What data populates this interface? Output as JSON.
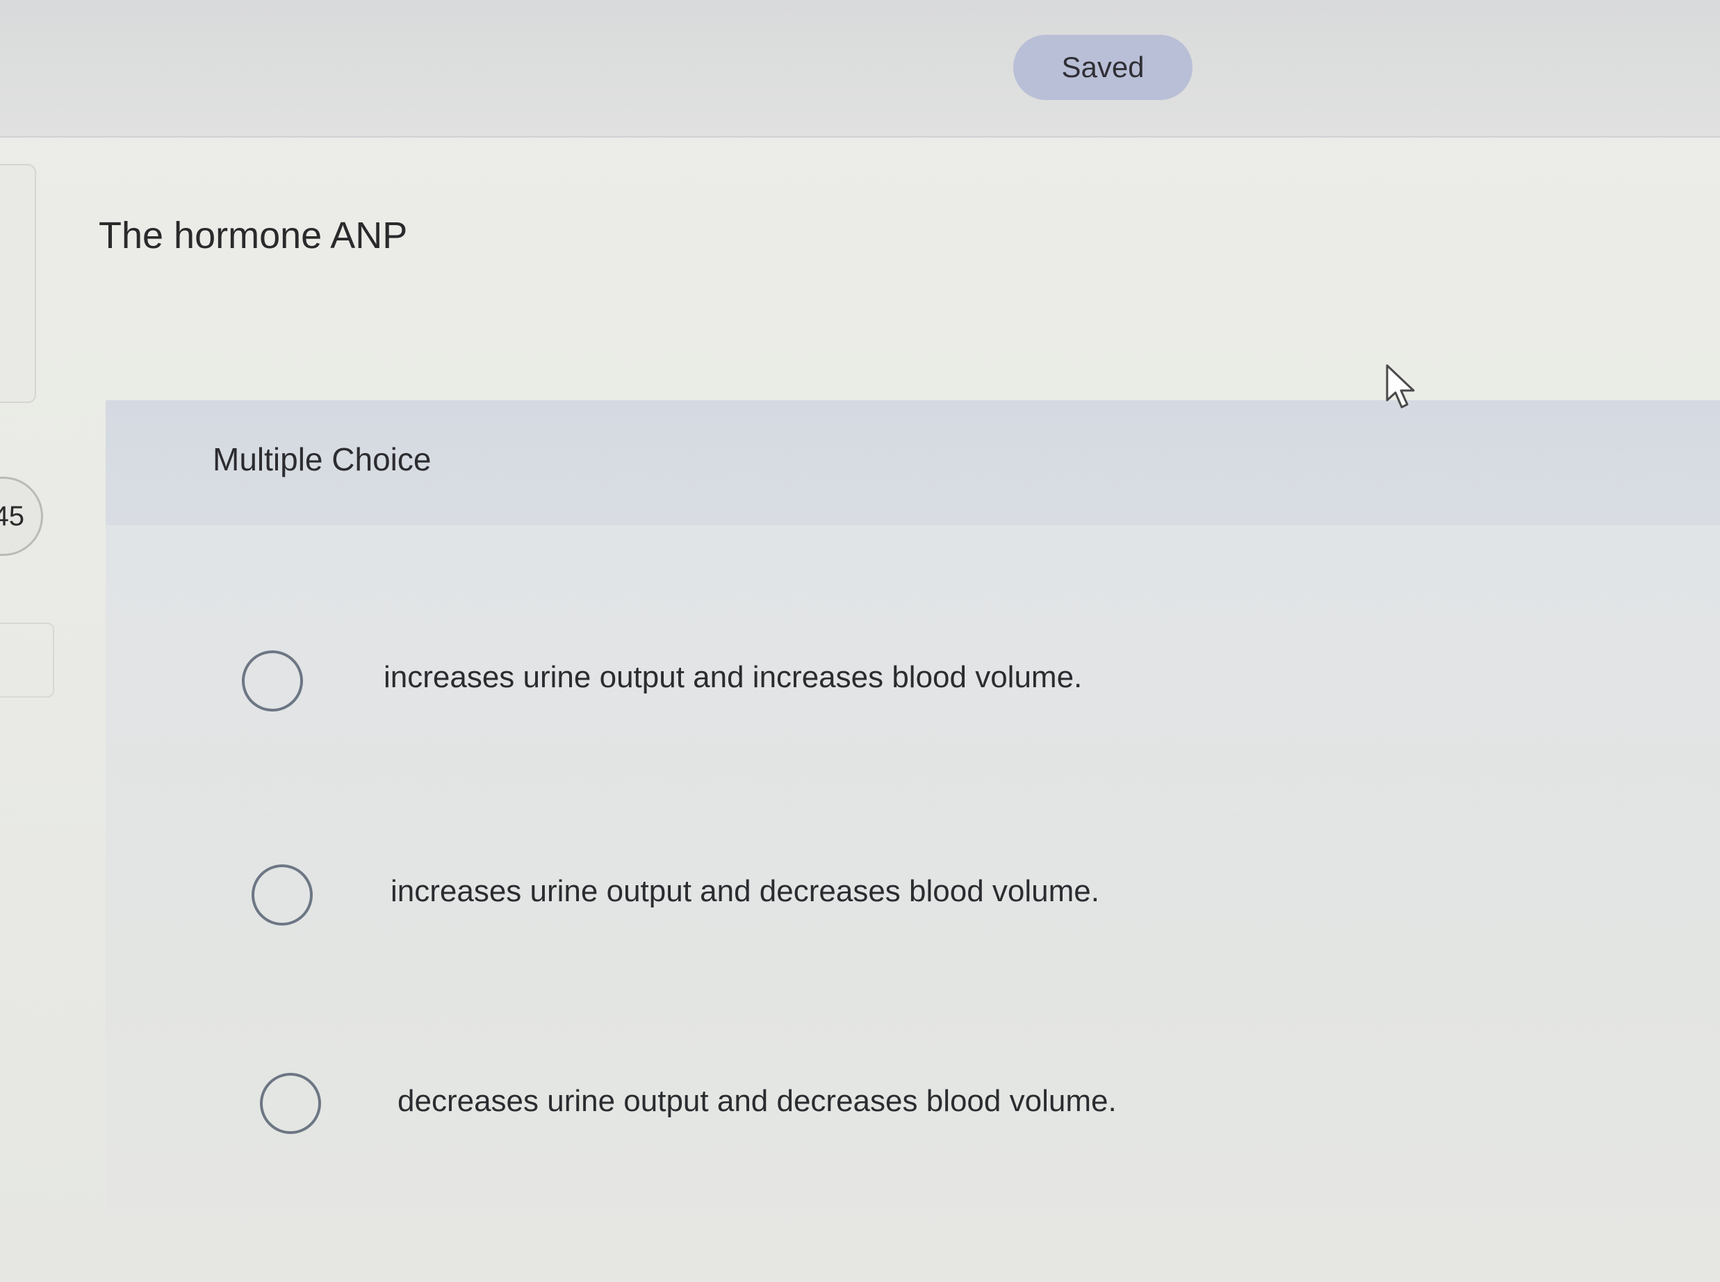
{
  "header": {
    "status_label": "Saved"
  },
  "sidebar": {
    "question_number_visible": "45"
  },
  "question": {
    "prompt": "The hormone ANP",
    "type_label": "Multiple Choice",
    "options": [
      {
        "label": "increases urine output and increases blood volume.",
        "selected": false
      },
      {
        "label": "increases urine output and decreases blood volume.",
        "selected": false
      },
      {
        "label": "decreases urine output and decreases blood volume.",
        "selected": false
      }
    ]
  },
  "icons": {
    "cursor": "mouse-pointer-icon",
    "radio": "radio-button-icon"
  },
  "colors": {
    "saved_pill": "#b9bfd6",
    "header_band": "#d5dae2",
    "radio_border": "#6d7684",
    "text": "#2a2a2c"
  }
}
